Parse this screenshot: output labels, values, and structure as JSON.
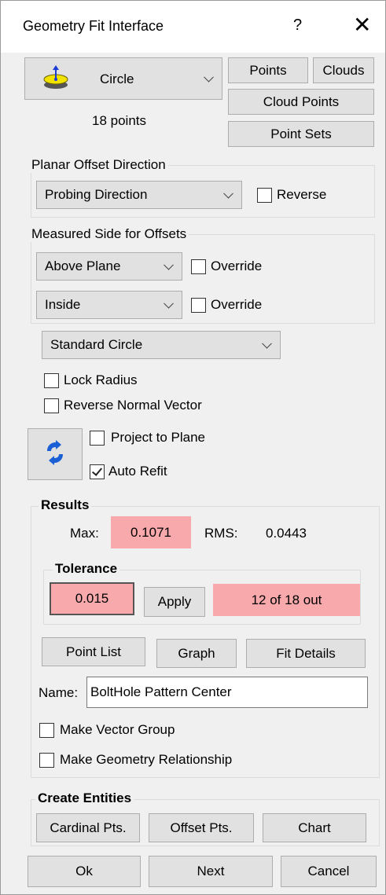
{
  "window": {
    "title": "Geometry Fit Interface",
    "help_label": "?",
    "close_label": "✕"
  },
  "geometry": {
    "selected": "Circle",
    "icon": "circle-geometry-icon",
    "point_count": "18 points"
  },
  "source_buttons": {
    "points": "Points",
    "clouds": "Clouds",
    "cloud_points": "Cloud Points",
    "point_sets": "Point Sets"
  },
  "planar_offset": {
    "label": "Planar Offset Direction",
    "direction": "Probing Direction",
    "reverse_label": "Reverse",
    "reverse_checked": false
  },
  "measured_side": {
    "label": "Measured Side for Offsets",
    "plane_side": "Above Plane",
    "override1_label": "Override",
    "override1_checked": false,
    "circle_side": "Inside",
    "override2_label": "Override",
    "override2_checked": false
  },
  "fit_type": "Standard Circle",
  "options": {
    "lock_radius": "Lock Radius",
    "lock_radius_checked": false,
    "reverse_normal": "Reverse Normal Vector",
    "reverse_normal_checked": false,
    "project_to_plane": "Project to Plane",
    "project_to_plane_checked": false,
    "auto_refit": "Auto Refit",
    "auto_refit_checked": true,
    "refit_icon": "refresh-icon"
  },
  "results": {
    "label": "Results",
    "max_label": "Max:",
    "max_value": "0.1071",
    "rms_label": "RMS:",
    "rms_value": "0.0443"
  },
  "tolerance": {
    "label": "Tolerance",
    "value": "0.015",
    "apply_label": "Apply",
    "status": "12 of 18 out"
  },
  "analysis_buttons": {
    "point_list": "Point List",
    "graph": "Graph",
    "fit_details": "Fit Details"
  },
  "name": {
    "label": "Name:",
    "value": "BoltHole Pattern Center"
  },
  "groups": {
    "make_vector_group": "Make Vector Group",
    "make_vector_group_checked": false,
    "make_geometry_relationship": "Make Geometry Relationship",
    "make_geometry_relationship_checked": false
  },
  "create_entities": {
    "label": "Create Entities",
    "cardinal_pts": "Cardinal Pts.",
    "offset_pts": "Offset Pts.",
    "chart": "Chart"
  },
  "footer": {
    "ok": "Ok",
    "next": "Next",
    "cancel": "Cancel"
  },
  "colors": {
    "highlight": "#f7a9ab",
    "button": "#e1e1e1",
    "background": "#f0f0f0",
    "refresh_icon": "#1a5fd6"
  }
}
